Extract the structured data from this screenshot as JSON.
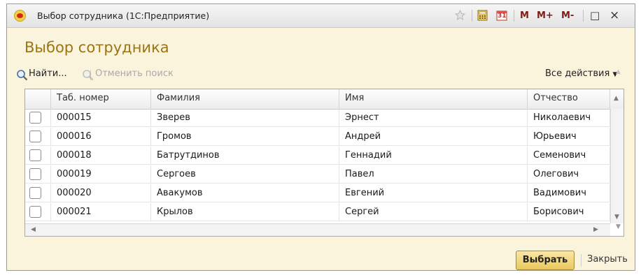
{
  "window": {
    "title": "Выбор сотрудника  (1С:Предприятие)",
    "icons": [
      "1c-logo-icon",
      "favorite-icon",
      "calculator-icon",
      "calendar-icon"
    ],
    "calendar_day": "31",
    "memory_buttons": [
      "M",
      "M+",
      "M-"
    ],
    "maximize_icon": "□",
    "close_icon": "×"
  },
  "form": {
    "heading": "Выбор сотрудника"
  },
  "toolbar": {
    "find_label": "Найти...",
    "cancel_search_label": "Отменить поиск",
    "all_actions_label": "Все действия"
  },
  "table": {
    "columns": [
      "Таб. номер",
      "Фамилия",
      "Имя",
      "Отчество"
    ],
    "rows": [
      {
        "checked": false,
        "tab": "000015",
        "last": "Зверев",
        "first": "Эрнест",
        "middle": "Николаевич"
      },
      {
        "checked": false,
        "tab": "000016",
        "last": "Громов",
        "first": "Андрей",
        "middle": "Юрьевич"
      },
      {
        "checked": false,
        "tab": "000018",
        "last": "Батрутдинов",
        "first": "Геннадий",
        "middle": "Семенович"
      },
      {
        "checked": false,
        "tab": "000019",
        "last": "Сергоев",
        "first": "Павел",
        "middle": "Олегович"
      },
      {
        "checked": false,
        "tab": "000020",
        "last": "Авакумов",
        "first": "Евгений",
        "middle": "Вадимович"
      },
      {
        "checked": false,
        "tab": "000021",
        "last": "Крылов",
        "first": "Сергей",
        "middle": "Борисович"
      }
    ]
  },
  "buttons": {
    "select": "Выбрать",
    "close": "Закрыть"
  },
  "colors": {
    "heading": "#9b7514",
    "window_bg": "#fbf4dc",
    "accent_button": "#e9c95e"
  }
}
